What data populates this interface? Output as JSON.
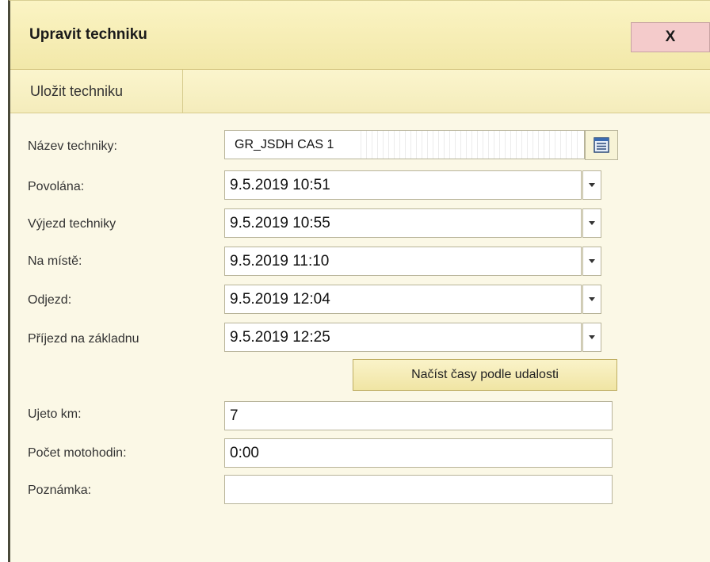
{
  "dialog": {
    "title": "Upravit techniku",
    "close_label": "X"
  },
  "toolbar": {
    "save_label": "Uložit techniku"
  },
  "form": {
    "name_label": "Název techniky:",
    "name_value": "GR_JSDH CAS 1",
    "povolana_label": "Povolána:",
    "povolana_value": "9.5.2019 10:51",
    "vyjezd_label": "Výjezd techniky",
    "vyjezd_value": "9.5.2019 10:55",
    "na_miste_label": "Na místě:",
    "na_miste_value": "9.5.2019 11:10",
    "odjezd_label": "Odjezd:",
    "odjezd_value": "9.5.2019 12:04",
    "prijezd_label": "Příjezd na základnu",
    "prijezd_value": "9.5.2019 12:25",
    "load_times_label": "Načíst časy podle udalosti",
    "km_label": "Ujeto km:",
    "km_value": "7",
    "motohodin_label": "Počet motohodin:",
    "motohodin_value": "0:00",
    "poznamka_label": "Poznámka:",
    "poznamka_value": ""
  },
  "icons": {
    "list_picker": "list-icon",
    "dropdown": "chevron-down-icon"
  },
  "colors": {
    "header_bg": "#f2e8a9",
    "close_bg": "#f4cbcb",
    "body_bg": "#fbf8e6"
  }
}
